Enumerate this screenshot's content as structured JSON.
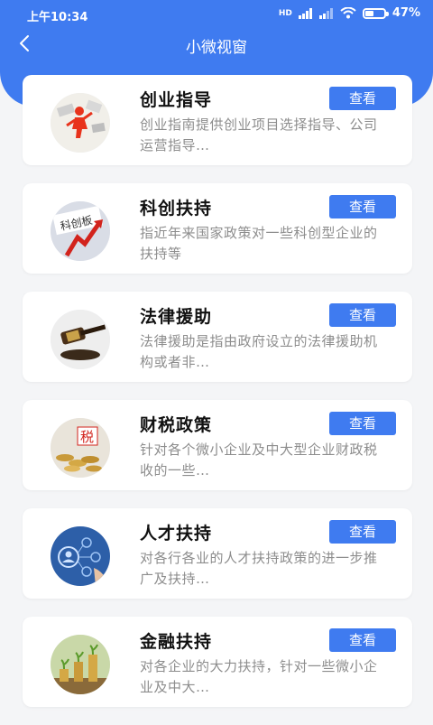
{
  "status": {
    "time": "上午10:34",
    "network": "HD",
    "battery": "47%",
    "battery_level": 0.47
  },
  "header": {
    "title": "小微视窗"
  },
  "colors": {
    "accent": "#3f7bf0",
    "background": "#f4f5f7"
  },
  "items": [
    {
      "title": "创业指导",
      "desc": "创业指南提供创业项目选择指导、公司运营指导…",
      "button": "查看",
      "image": "entrepreneur-image"
    },
    {
      "title": "科创扶持",
      "desc": "指近年来国家政策对一些科创型企业的扶持等",
      "button": "查看",
      "image": "innovation-image",
      "image_text": "科创板"
    },
    {
      "title": "法律援助",
      "desc": "法律援助是指由政府设立的法律援助机构或者非…",
      "button": "查看",
      "image": "gavel-image"
    },
    {
      "title": "财税政策",
      "desc": "针对各个微小企业及中大型企业财政税收的一些…",
      "button": "查看",
      "image": "tax-image",
      "image_text": "税"
    },
    {
      "title": "人才扶持",
      "desc": "对各行各业的人才扶持政策的进一步推广及扶持…",
      "button": "查看",
      "image": "talent-image"
    },
    {
      "title": "金融扶持",
      "desc": "对各企业的大力扶持，针对一些微小企业及中大…",
      "button": "查看",
      "image": "finance-image"
    }
  ]
}
